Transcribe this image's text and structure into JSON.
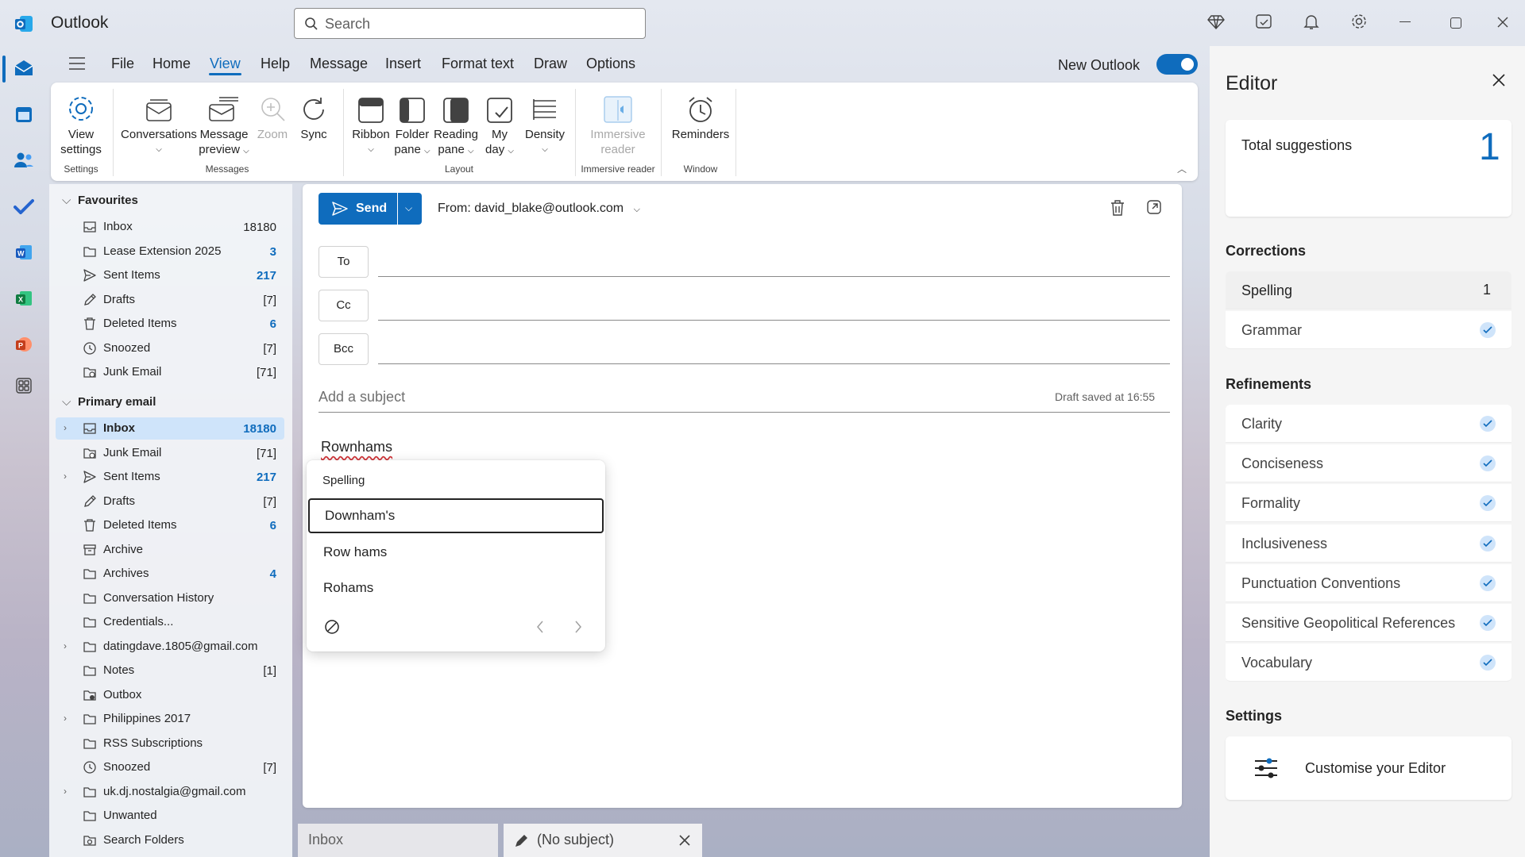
{
  "app": {
    "title": "Outlook"
  },
  "search": {
    "placeholder": "Search"
  },
  "titlebar_icons": [
    "premium-icon",
    "my-day-icon",
    "bell-icon",
    "gear-icon",
    "minimize-icon",
    "restore-icon",
    "close-icon"
  ],
  "menu": {
    "tabs": [
      "File",
      "Home",
      "View",
      "Help",
      "Message",
      "Insert",
      "Format text",
      "Draw",
      "Options"
    ],
    "active": "View",
    "new_outlook_label": "New Outlook",
    "new_outlook_on": true
  },
  "ribbon": {
    "view_settings": [
      "View",
      "settings"
    ],
    "settings_group": "Settings",
    "conversations": "Conversations",
    "message_preview": [
      "Message",
      "preview"
    ],
    "zoom": "Zoom",
    "sync": "Sync",
    "messages_group": "Messages",
    "ribbon": "Ribbon",
    "folder_pane": [
      "Folder",
      "pane"
    ],
    "reading_pane": [
      "Reading",
      "pane"
    ],
    "my_day": [
      "My",
      "day"
    ],
    "density": "Density",
    "layout_group": "Layout",
    "immersive_reader": [
      "Immersive",
      "reader"
    ],
    "immersive_group": "Immersive reader",
    "reminders": "Reminders",
    "window_group": "Window"
  },
  "folders": {
    "favourites_label": "Favourites",
    "favourites": [
      {
        "label": "Inbox",
        "count": "18180",
        "blue": false,
        "icon": "inbox-icon"
      },
      {
        "label": "Lease Extension 2025",
        "count": "3",
        "blue": true,
        "icon": "folder-icon"
      },
      {
        "label": "Sent Items",
        "count": "217",
        "blue": true,
        "icon": "send-icon"
      },
      {
        "label": "Drafts",
        "count": "[7]",
        "blue": false,
        "icon": "drafts-icon"
      },
      {
        "label": "Deleted Items",
        "count": "6",
        "blue": true,
        "icon": "trash-icon"
      },
      {
        "label": "Snoozed",
        "count": "[7]",
        "blue": false,
        "icon": "clock-icon"
      },
      {
        "label": "Junk Email",
        "count": "[71]",
        "blue": false,
        "icon": "junk-icon"
      }
    ],
    "primary_label": "Primary email",
    "primary": [
      {
        "label": "Inbox",
        "count": "18180",
        "blue": true,
        "icon": "inbox-icon",
        "selected": true,
        "expand": true
      },
      {
        "label": "Junk Email",
        "count": "[71]",
        "blue": false,
        "icon": "junk-icon"
      },
      {
        "label": "Sent Items",
        "count": "217",
        "blue": true,
        "icon": "send-icon",
        "expand": true
      },
      {
        "label": "Drafts",
        "count": "[7]",
        "blue": false,
        "icon": "drafts-icon"
      },
      {
        "label": "Deleted Items",
        "count": "6",
        "blue": true,
        "icon": "trash-icon"
      },
      {
        "label": "Archive",
        "count": "",
        "blue": false,
        "icon": "archive-icon"
      },
      {
        "label": "Archives",
        "count": "4",
        "blue": true,
        "icon": "folder-icon"
      },
      {
        "label": "Conversation History",
        "count": "",
        "blue": false,
        "icon": "folder-icon"
      },
      {
        "label": "Credentials...",
        "count": "",
        "blue": false,
        "icon": "folder-icon"
      },
      {
        "label": "datingdave.1805@gmail.com",
        "count": "",
        "blue": false,
        "icon": "folder-icon",
        "expand": true
      },
      {
        "label": "Notes",
        "count": "[1]",
        "blue": false,
        "icon": "folder-icon"
      },
      {
        "label": "Outbox",
        "count": "",
        "blue": false,
        "icon": "outbox-icon"
      },
      {
        "label": "Philippines 2017",
        "count": "",
        "blue": false,
        "icon": "folder-icon",
        "expand": true
      },
      {
        "label": "RSS Subscriptions",
        "count": "",
        "blue": false,
        "icon": "folder-icon"
      },
      {
        "label": "Snoozed",
        "count": "[7]",
        "blue": false,
        "icon": "clock-icon"
      },
      {
        "label": "uk.dj.nostalgia@gmail.com",
        "count": "",
        "blue": false,
        "icon": "folder-icon",
        "expand": true
      },
      {
        "label": "Unwanted",
        "count": "",
        "blue": false,
        "icon": "folder-icon"
      },
      {
        "label": "Search Folders",
        "count": "",
        "blue": false,
        "icon": "search-folder-icon"
      }
    ]
  },
  "compose": {
    "send": "Send",
    "from": "From: david_blake@outlook.com",
    "to": "To",
    "cc": "Cc",
    "bcc": "Bcc",
    "subject_placeholder": "Add a subject",
    "draft_status": "Draft saved at 16:55",
    "body": "Rownhams"
  },
  "spelling_popup": {
    "title": "Spelling",
    "suggestions": [
      "Downham's",
      "Row hams",
      "Rohams"
    ]
  },
  "bottom_tabs": {
    "inbox": "Inbox",
    "draft": "(No subject)"
  },
  "editor": {
    "title": "Editor",
    "total_label": "Total suggestions",
    "total": "1",
    "corrections_label": "Corrections",
    "corrections": [
      {
        "label": "Spelling",
        "value": "1"
      },
      {
        "label": "Grammar",
        "checked": true
      }
    ],
    "refinements_label": "Refinements",
    "refinements": [
      "Clarity",
      "Conciseness",
      "Formality",
      "Inclusiveness",
      "Punctuation Conventions",
      "Sensitive Geopolitical References",
      "Vocabulary"
    ],
    "settings_label": "Settings",
    "customise": "Customise your Editor"
  },
  "colors": {
    "accent": "#0f6cbd",
    "selected": "#cfe4fa",
    "misspelling": "#d13438"
  }
}
